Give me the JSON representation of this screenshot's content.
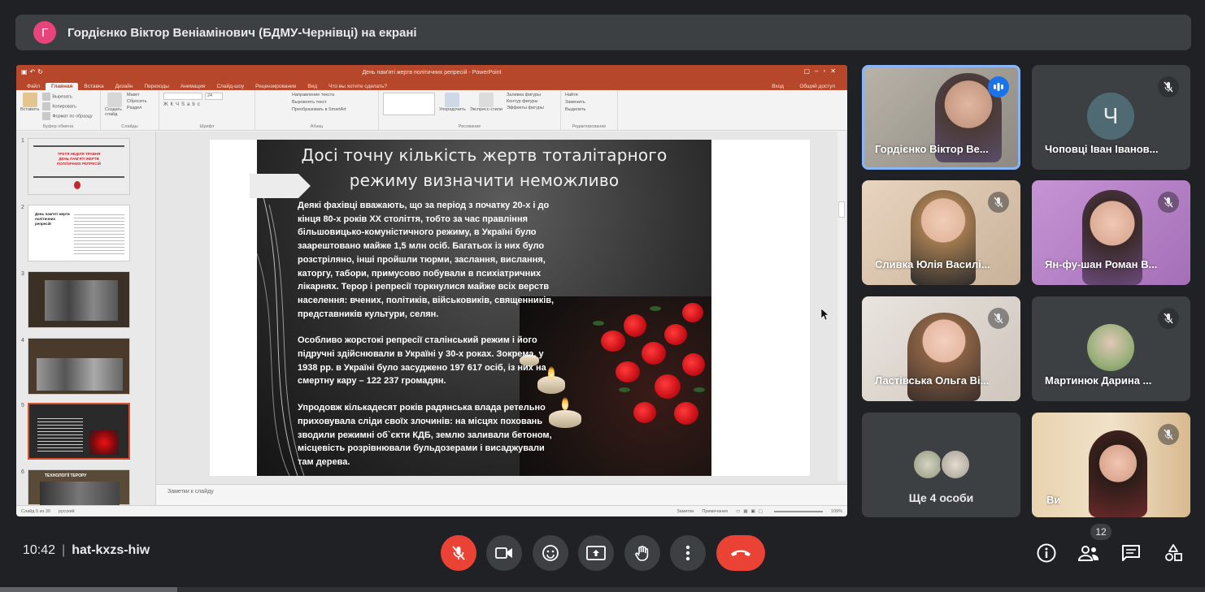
{
  "banner": {
    "avatar_letter": "Г",
    "text": "Гордієнко Віктор Веніамінович (БДМУ-Чернівці) на екрані"
  },
  "powerpoint": {
    "window_title": "День пам'яті жертв політичних репресій - PowerPoint",
    "tabs": [
      "Файл",
      "Главная",
      "Вставка",
      "Дизайн",
      "Переходы",
      "Анимация",
      "Слайд-шоу",
      "Рецензирование",
      "Вид",
      "Что вы хотите сделать?"
    ],
    "tabs_right": [
      "Вход",
      "Общий доступ"
    ],
    "ribbon_groups": {
      "clipboard": {
        "name": "Буфер обмена",
        "items": [
          "Вставить",
          "Вырезать",
          "Копировать",
          "Формат по образцу"
        ]
      },
      "slides": {
        "name": "Слайды",
        "items": [
          "Создать слайд",
          "Макет",
          "Сбросить",
          "Раздел"
        ]
      },
      "font": {
        "name": "Шрифт",
        "size": "24"
      },
      "paragraph": {
        "name": "Абзац",
        "items": [
          "Направление текста",
          "Выровнять текст",
          "Преобразовать в SmartArt"
        ]
      },
      "drawing": {
        "name": "Рисование",
        "items": [
          "Упорядочить",
          "Экспресс-стили",
          "Заливка фигуры",
          "Контур фигуры",
          "Эффекты фигуры"
        ]
      },
      "editing": {
        "name": "Редактирование",
        "items": [
          "Найти",
          "Заменить",
          "Выделить"
        ]
      }
    },
    "thumbnail_numbers": [
      "1",
      "2",
      "3",
      "4",
      "5",
      "6"
    ],
    "thumbnail_1_text": [
      "ТРЕТЯ НЕДІЛЯ ТРАВНЯ",
      "ДЕНЬ ПАМ'ЯТІ ЖЕРТВ",
      "ПОЛІТИЧНИХ РЕПРЕСІЙ"
    ],
    "thumbnail_2_title": "День пам'яті жертв політичних репресій",
    "thumbnail_6_title": "ТЕХНОЛОГІЇ ТЕРОРУ",
    "notes_placeholder": "Заметки к слайду",
    "status": {
      "slide": "Слайд 5 из 30",
      "lang": "русский",
      "notes": "Заметки",
      "comments": "Примечания",
      "zoom": "109%"
    }
  },
  "slide": {
    "title_line1": "Досі точну кількість жертв тоталітарного",
    "title_line2": "режиму визначити неможливо",
    "paragraph1": "Деякі фахівці вважають, що за період з початку 20-х і до кінця 80-х років XX століття, тобто за час правління більшовицько-комуністичного режиму, в Україні було заарештовано майже 1,5 млн осіб. Багатьох із них було розстріляно, інші пройшли тюрми, заслання, вислання, каторгу, табори, примусово побували в психіатричних лікарнях. Терор і репресії торкнулися майже всіх верств населення: вчених, політиків, військовиків, священників, представників культури, селян.",
    "paragraph2": "Особливо жорстокі репресії сталінський режим і його підручні здійснювали в Україні у 30-х роках. Зокрема, у 1938 рр. в Україні було засуджено 197 617 осіб, із них на смертну кару – 122 237 громадян.",
    "paragraph3": "Упродовж кількадесят років радянська влада ретельно приховувала сліди своїх злочинів: на місцях поховань зводили режимні об`єкти КДБ, землю заливали бетоном, місцевість розрівнювали бульдозерами і висаджували там дерева."
  },
  "participants": [
    {
      "name": "Гордієнко Віктор Ве...",
      "speaking": true
    },
    {
      "name": "Чоповці Іван Іванов...",
      "avatar_letter": "Ч"
    },
    {
      "name": "Сливка Юлія Василі..."
    },
    {
      "name": "Ян-фу-шан Роман В..."
    },
    {
      "name": "Ластівська Ольга Ві..."
    },
    {
      "name": "Мартинюк Дарина ..."
    },
    {
      "name": "Ви"
    }
  ],
  "more_tile": {
    "label": "Ще 4 особи"
  },
  "bottom": {
    "time": "10:42",
    "separator": "|",
    "meeting_code": "hat-kxzs-hiw",
    "participant_count": "12"
  },
  "colors": {
    "accent_red": "#ea4335",
    "speaker_ring": "#8ab4f8",
    "ppt_red": "#b7472a",
    "tile_bg": "#3c4043"
  }
}
